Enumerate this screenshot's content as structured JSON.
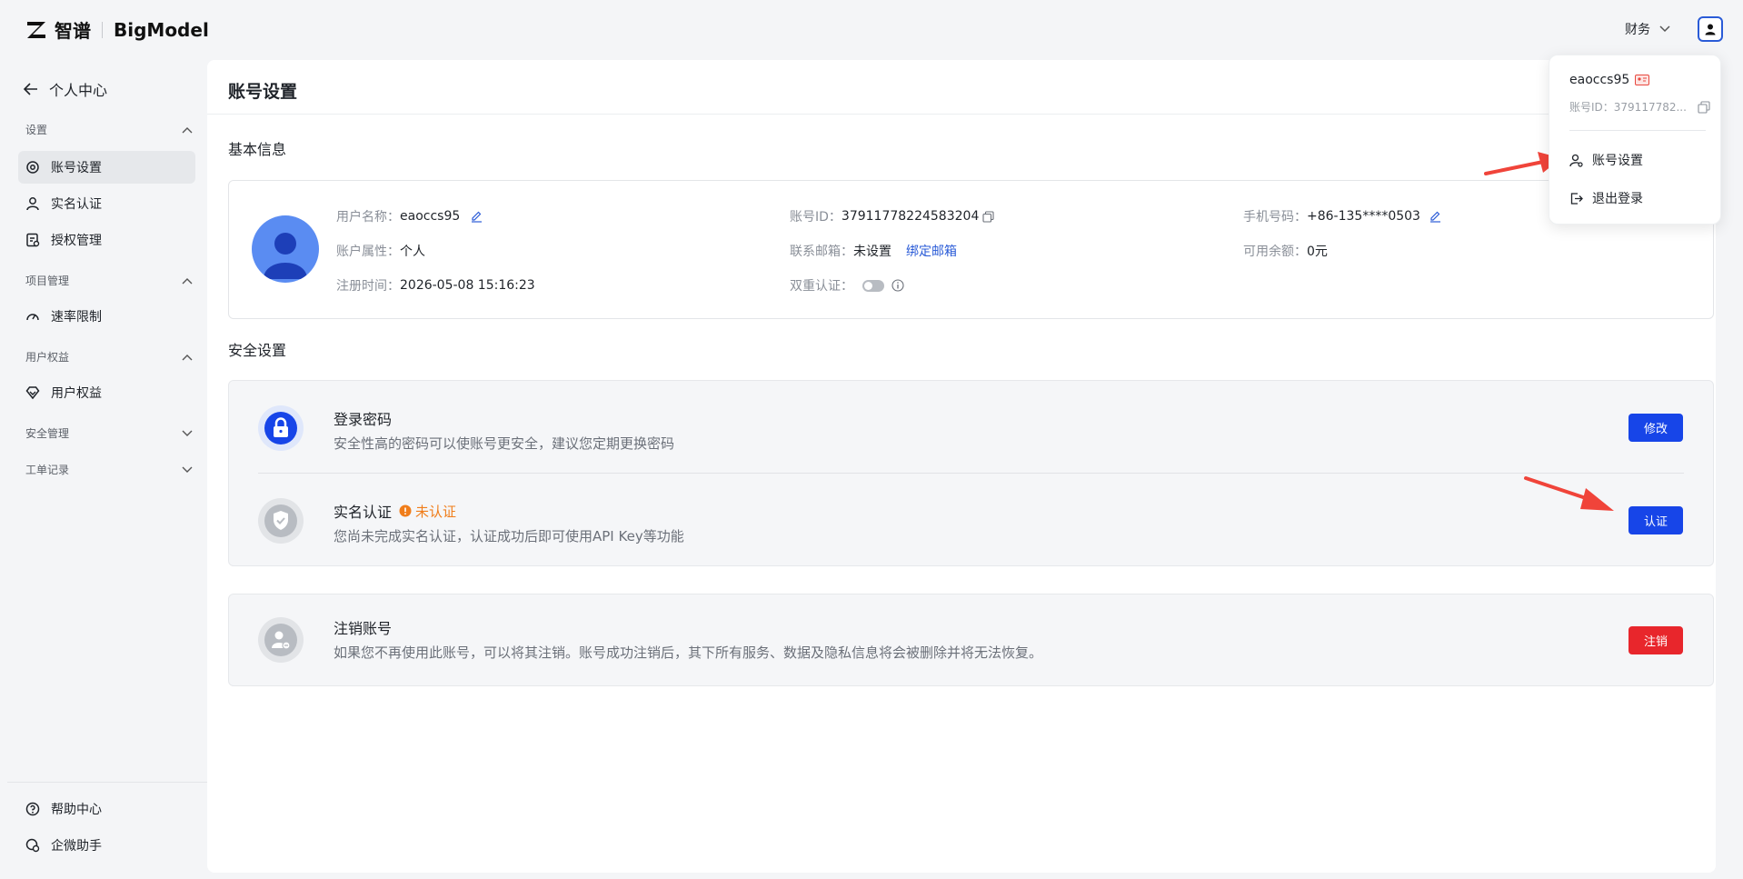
{
  "header": {
    "brand_cn": "智谱",
    "brand_en": "BigModel",
    "finance_label": "财务"
  },
  "sidebar": {
    "back_label": "个人中心",
    "sections": [
      {
        "label": "设置"
      },
      {
        "label": "项目管理"
      },
      {
        "label": "用户权益"
      },
      {
        "label": "安全管理"
      },
      {
        "label": "工单记录"
      }
    ],
    "items": [
      {
        "label": "账号设置"
      },
      {
        "label": "实名认证"
      },
      {
        "label": "授权管理"
      },
      {
        "label": "速率限制"
      },
      {
        "label": "用户权益"
      }
    ],
    "bottom": [
      {
        "label": "帮助中心"
      },
      {
        "label": "企微助手"
      }
    ]
  },
  "main": {
    "title": "账号设置",
    "basic_info": {
      "heading": "基本信息",
      "username_label": "用户名称：",
      "username": "eaoccs95",
      "account_id_label": "账号ID：",
      "account_id": "37911778224583204",
      "phone_label": "手机号码：",
      "phone": "+86-135****0503",
      "attr_label": "账户属性：",
      "attr": "个人",
      "email_label": "联系邮箱：",
      "email": "未设置",
      "bind_email": "绑定邮箱",
      "balance_label": "可用余额：",
      "balance": "0元",
      "reg_label": "注册时间：",
      "reg_time": "2026-05-08 15:16:23",
      "twofa_label": "双重认证："
    },
    "security": {
      "heading": "安全设置",
      "password_title": "登录密码",
      "password_desc": "安全性高的密码可以使账号更安全，建议您定期更换密码",
      "password_btn": "修改",
      "realname_title": "实名认证",
      "realname_status": "未认证",
      "realname_desc": "您尚未完成实名认证，认证成功后即可使用API Key等功能",
      "realname_btn": "认证"
    },
    "cancel": {
      "title": "注销账号",
      "desc": "如果您不再使用此账号，可以将其注销。账号成功注销后，其下所有服务、数据及隐私信息将会被删除并将无法恢复。",
      "btn": "注销"
    }
  },
  "dropdown": {
    "name": "eaoccs95",
    "id_label": "账号ID：",
    "id_value": "379117782...",
    "items": [
      {
        "label": "账号设置"
      },
      {
        "label": "退出登录"
      }
    ]
  },
  "colors": {
    "accent": "#1745e8",
    "danger": "#e8262c",
    "warning": "#f07d1a",
    "annotation_arrow": "#f0443a"
  }
}
